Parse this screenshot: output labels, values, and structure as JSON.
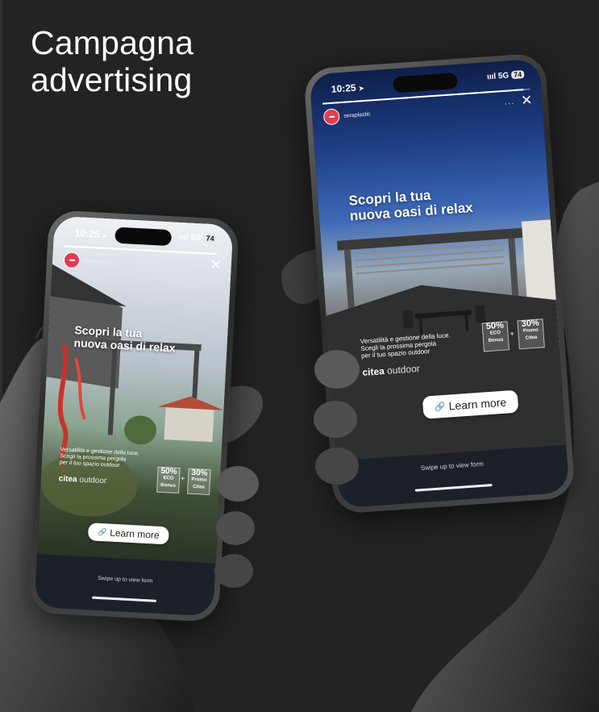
{
  "headline": {
    "line1": "Campagna",
    "line2": "advertising"
  },
  "story": {
    "status_time": "10:25",
    "status_arrow": "➤",
    "signal": "5G",
    "battery": "74",
    "account_name": "seraplastic",
    "more": "···",
    "close": "✕",
    "title_line1": "Scopri la tua",
    "title_line2": "nuova oasi di relax",
    "body_line1": "Versatilità e gestione della luce.",
    "body_line2": "Scegli la prossima pergola",
    "body_line3": "per il tuo spazio outdoor",
    "badge1_pct": "50%",
    "badge1_sub1": "ECO",
    "badge1_sub2": "Bonus",
    "plus": "+",
    "badge2_pct": "30%",
    "badge2_sub1": "Promo",
    "badge2_sub2": "Citea",
    "brand_bold": "citea",
    "brand_light": "outdoor",
    "learn_icon": "🔗",
    "learn_label": "Learn more",
    "swipe": "Swipe up to view form",
    "progress": 0.97
  },
  "colors": {
    "background": "#232323",
    "headline": "#ffffff",
    "avatar": "#e23b55",
    "screen_bottom": "#1c2129",
    "link_icon": "#2a7bd8"
  }
}
